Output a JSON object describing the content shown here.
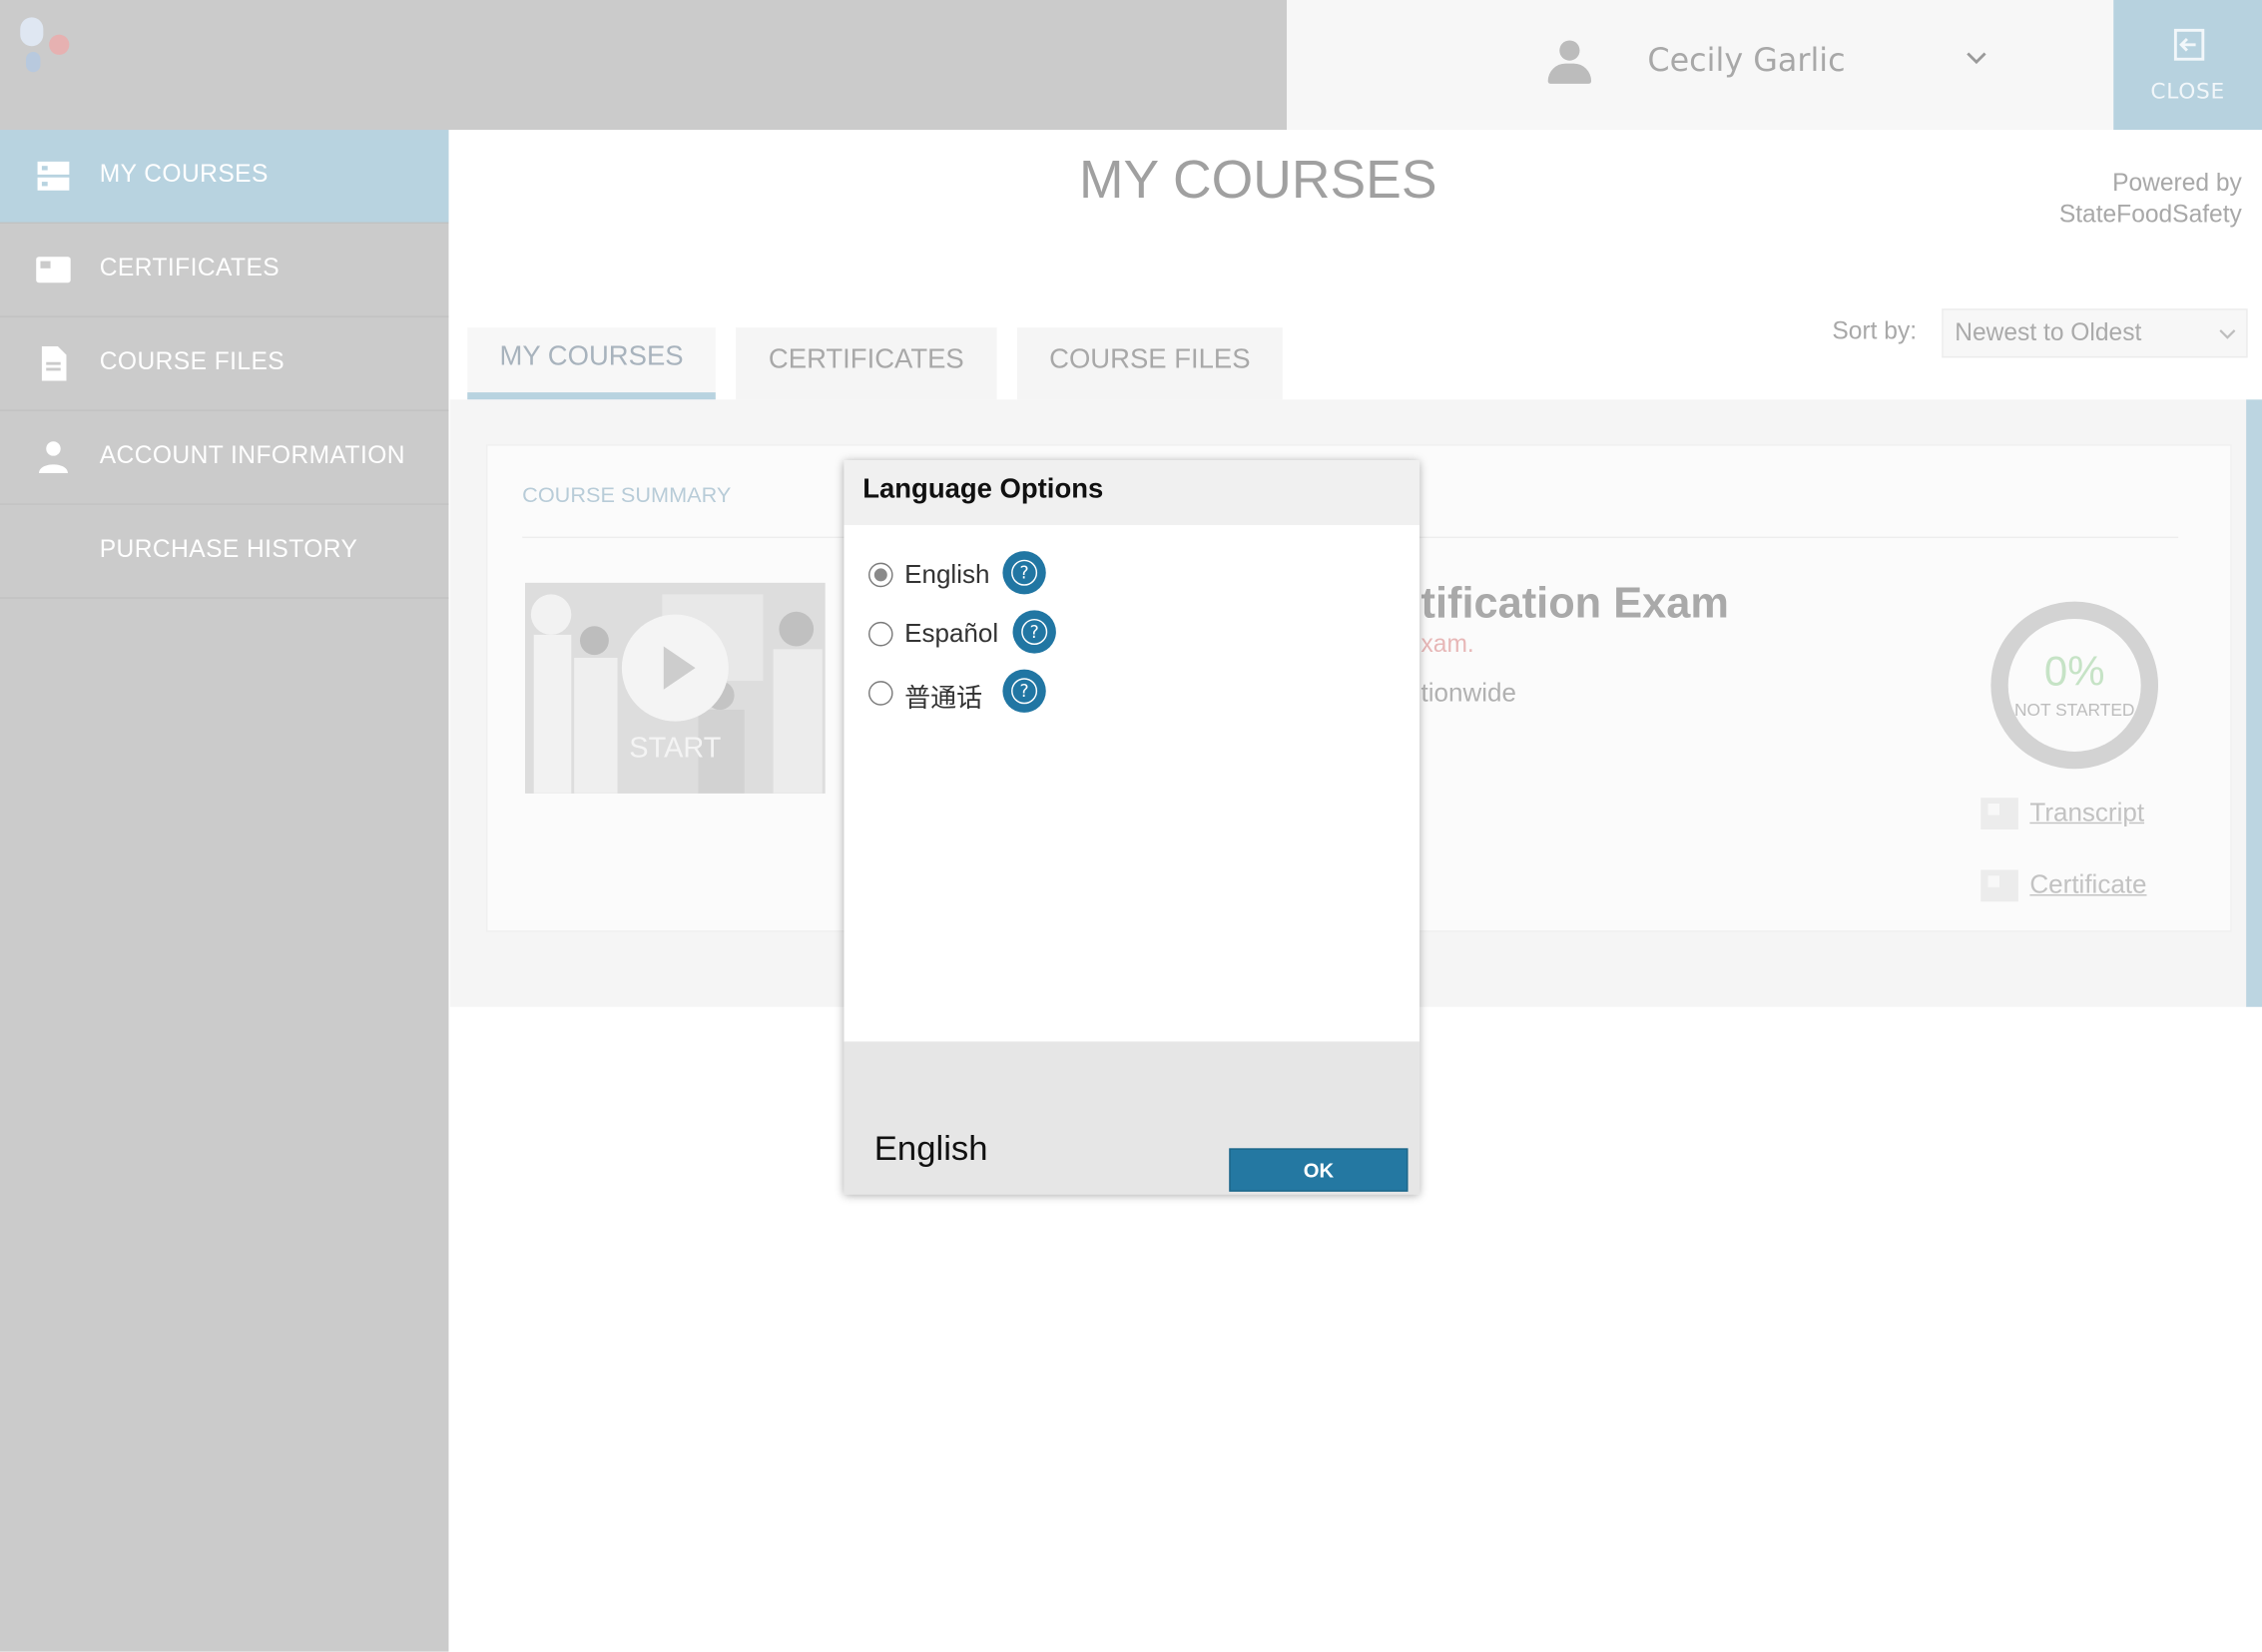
{
  "header": {
    "user_name": "Cecily Garlic",
    "close_label": "CLOSE"
  },
  "sidebar": {
    "items": [
      {
        "label": "MY COURSES",
        "icon": "courses-icon",
        "active": true
      },
      {
        "label": "CERTIFICATES",
        "icon": "certificate-icon"
      },
      {
        "label": "COURSE FILES",
        "icon": "file-icon"
      },
      {
        "label": "ACCOUNT INFORMATION",
        "icon": "person-icon"
      },
      {
        "label": "PURCHASE HISTORY",
        "icon": ""
      }
    ]
  },
  "main": {
    "title": "MY COURSES",
    "powered_by_line1": "Powered by",
    "powered_by_line2": "StateFoodSafety",
    "tabs": [
      {
        "label": "MY COURSES",
        "active": true
      },
      {
        "label": "CERTIFICATES"
      },
      {
        "label": "COURSE FILES"
      }
    ],
    "sort_label": "Sort by:",
    "sort_value": "Newest to Oldest"
  },
  "course_card": {
    "summary_label": "COURSE SUMMARY",
    "start_label": "START",
    "title_partial": "tification Exam",
    "subtitle_partial": "xam.",
    "location_partial": "tionwide",
    "progress_percent": "0%",
    "progress_value": 0,
    "status": "NOT STARTED",
    "transcript_link": "Transcript",
    "certificate_link": "Certificate"
  },
  "modal": {
    "title": "Language Options",
    "options": [
      {
        "label": "English",
        "selected": true
      },
      {
        "label": "Español",
        "selected": false
      },
      {
        "label": "普通话",
        "selected": false
      }
    ],
    "help_glyph": "?",
    "footer_language": "English",
    "ok_label": "OK"
  },
  "colors": {
    "accent": "#2478a2",
    "sidebar_active": "#b8d3e0",
    "sidebar_bg": "#cbcbcb"
  }
}
